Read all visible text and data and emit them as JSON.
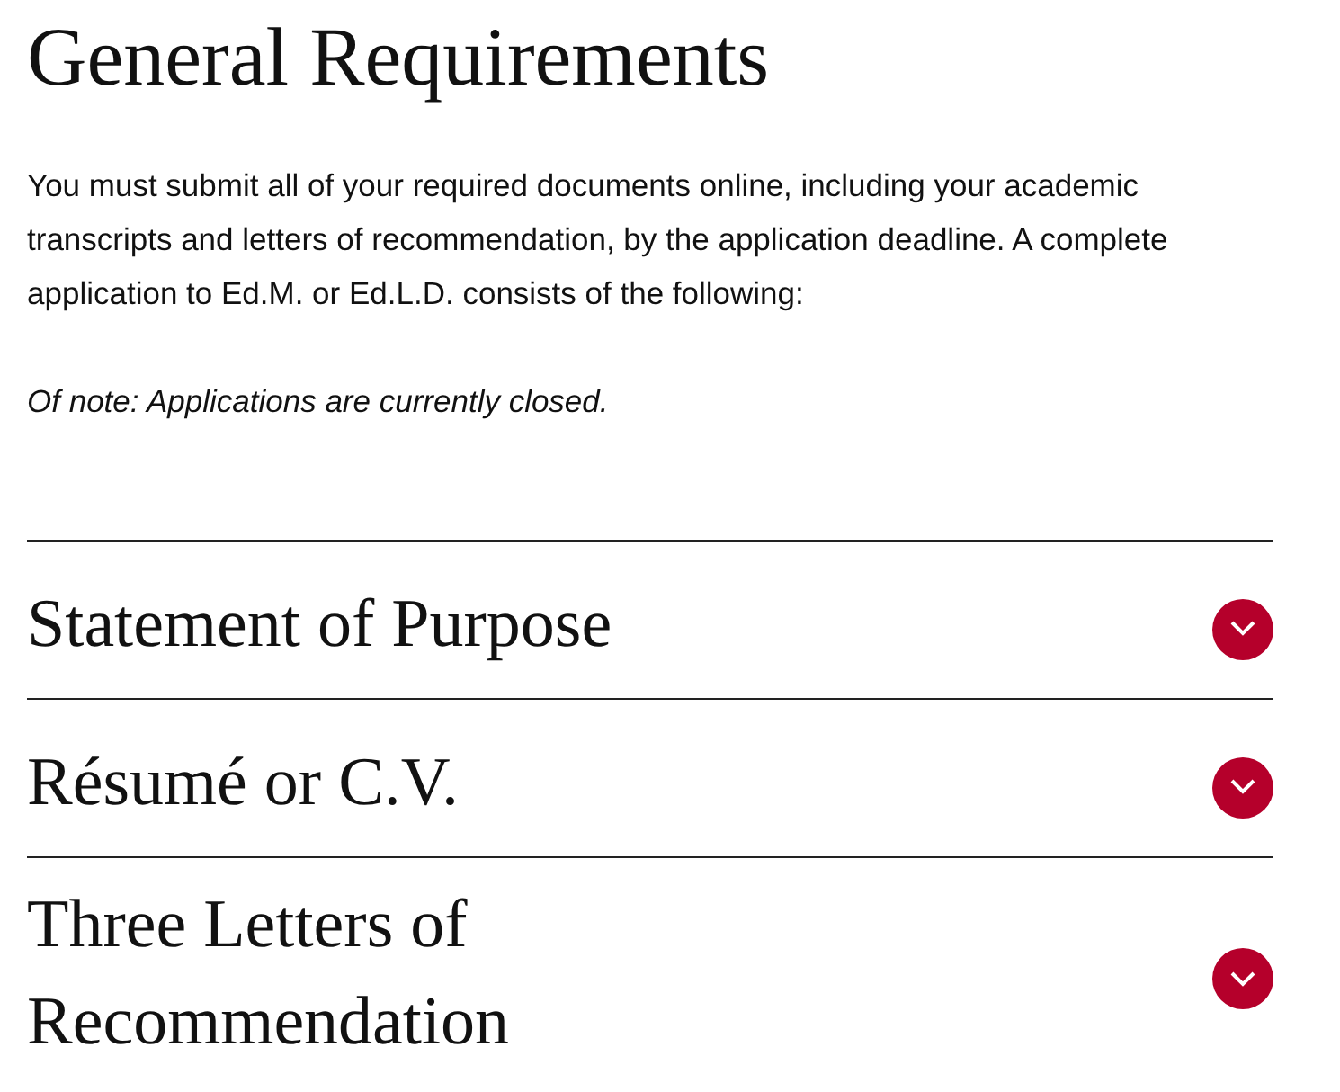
{
  "heading": "General Requirements",
  "intro": "You must submit all of your required documents online, including your academic transcripts and letters of recommendation, by the application deadline. A complete application to Ed.M. or Ed.L.D. consists of the following:",
  "note": "Of note: Applications are currently closed.",
  "accordion": [
    {
      "title": "Statement of Purpose",
      "expanded": false
    },
    {
      "title": "Résumé or C.V.",
      "expanded": false
    },
    {
      "title": "Three Letters of Recommendation",
      "expanded": false
    }
  ]
}
